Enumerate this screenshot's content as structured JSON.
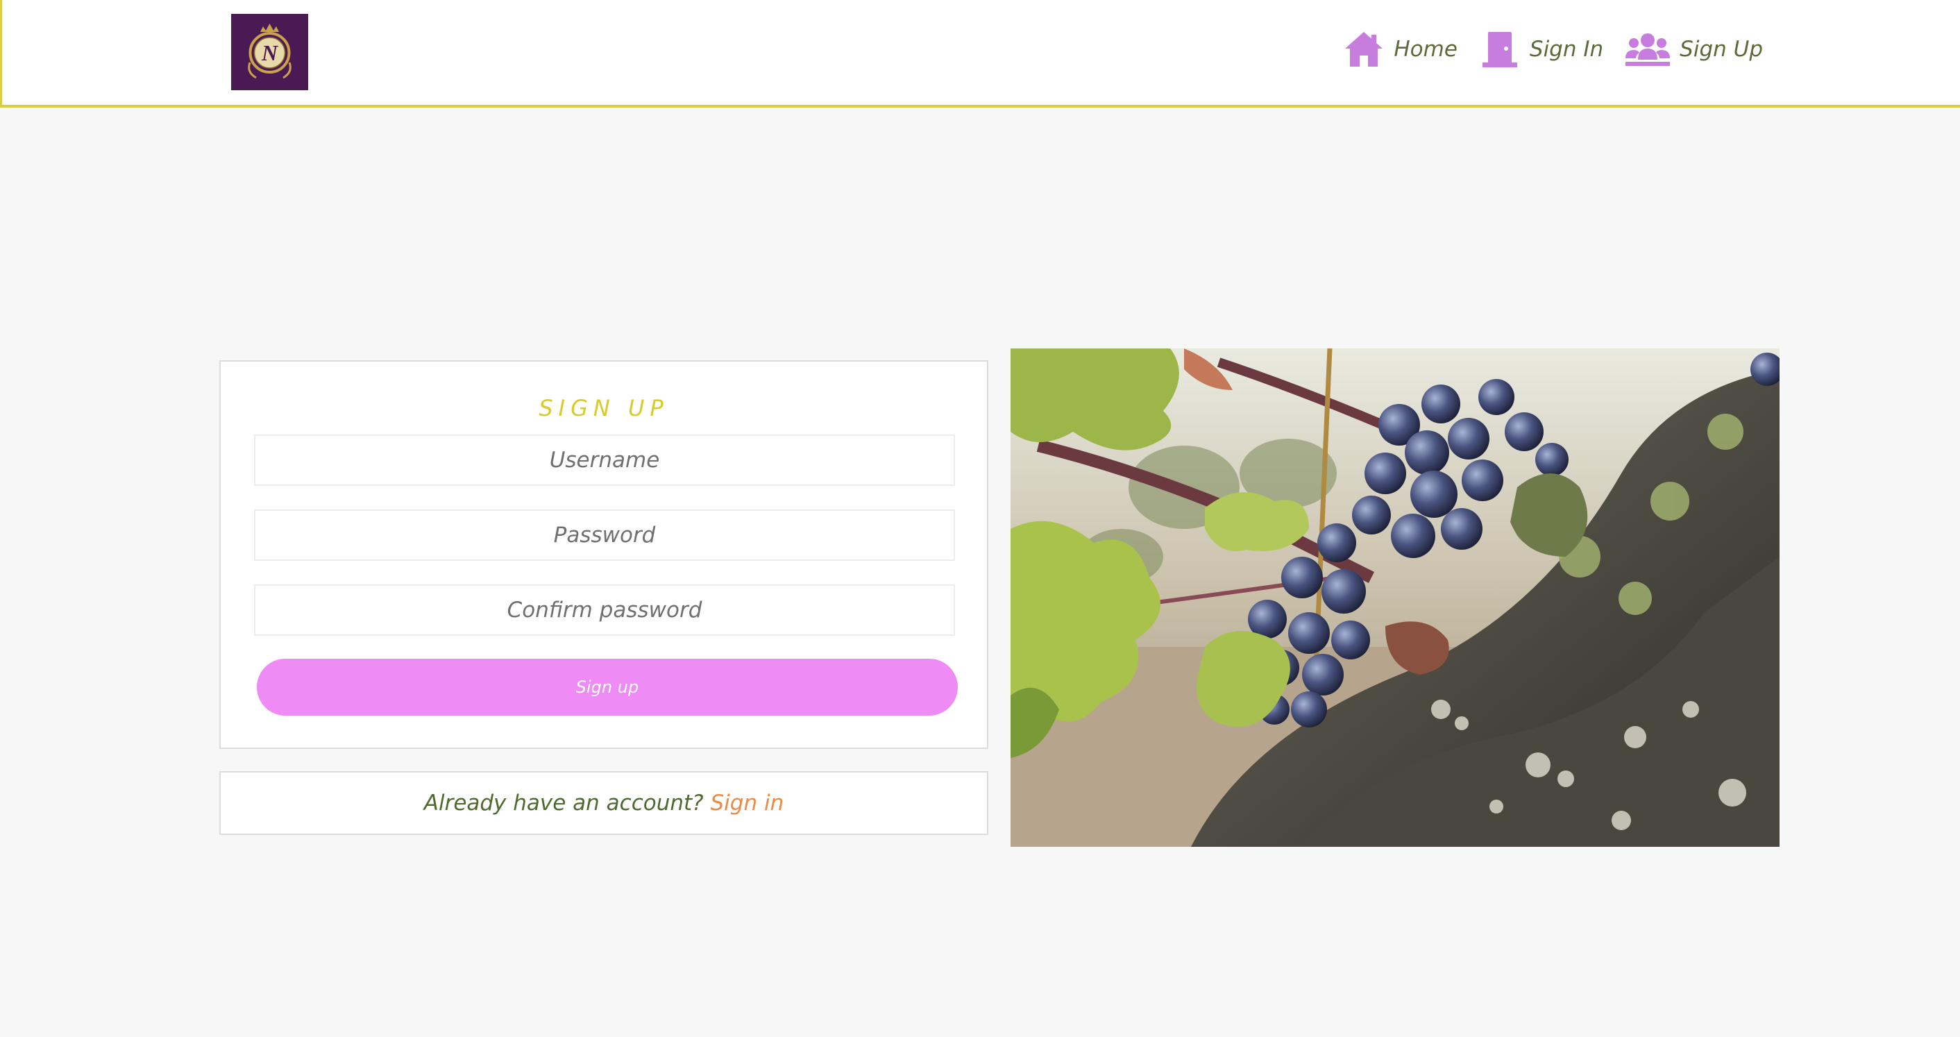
{
  "header": {
    "logo": {
      "letter": "N",
      "colors": {
        "bg": "#4a1a55",
        "gold": "#c9a24a"
      }
    },
    "nav": [
      {
        "label": "Home",
        "icon": "home-icon"
      },
      {
        "label": "Sign In",
        "icon": "door-icon"
      },
      {
        "label": "Sign Up",
        "icon": "users-icon"
      }
    ]
  },
  "signup_form": {
    "title": "SIGN UP",
    "fields": [
      {
        "placeholder": "Username",
        "value": ""
      },
      {
        "placeholder": "Password",
        "value": ""
      },
      {
        "placeholder": "Confirm password",
        "value": ""
      }
    ],
    "submit_label": "Sign up"
  },
  "signin_prompt": {
    "text": "Already have an account?",
    "link_label": "Sign in"
  },
  "colors": {
    "accent_yellow": "#dccd45",
    "button_pink": "#ee8bf4",
    "icon_purple": "#c77ddd",
    "nav_text": "#5b6b3a",
    "link_orange": "#ec8a47"
  }
}
